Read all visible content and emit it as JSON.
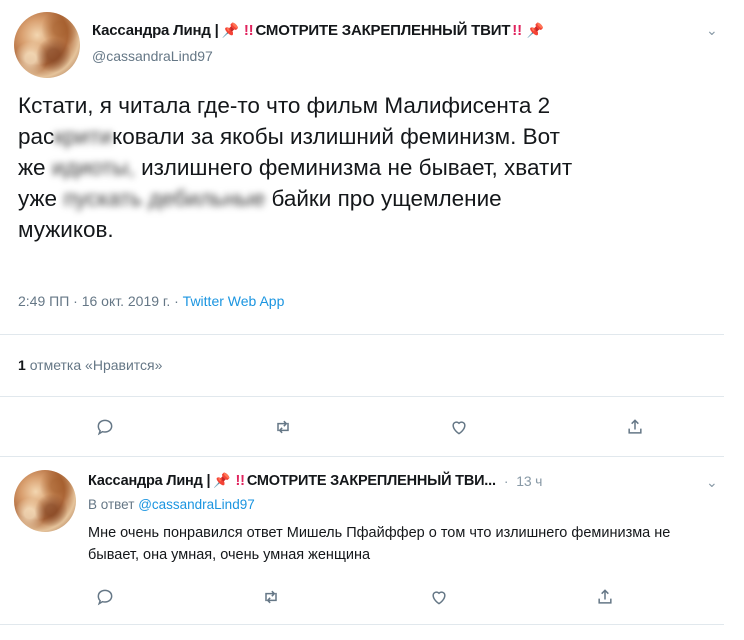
{
  "main_tweet": {
    "author_name": "Кассандра Линд |",
    "pin_icon": "📌",
    "bang": "!!",
    "pinned_label": "СМОТРИТЕ ЗАКРЕПЛЕННЫЙ ТВИТ",
    "handle": "@cassandraLind97",
    "text_line1": "Кстати, я читала где-то что фильм Малифисента 2",
    "text_line2_a": "рас",
    "text_line2_blur": "крити",
    "text_line2_b": "ковали за якобы излишний феминизм. Вот",
    "text_line3_a": "же ",
    "text_line3_blur": "идиоты,",
    "text_line3_b": " излишнего феминизма не бывает, хватит",
    "text_line4_a": "уже ",
    "text_line4_blur": "пускать дебильные",
    "text_line4_b": " байки про ущемление",
    "text_line5": "мужиков.",
    "time": "2:49 ПП",
    "sep": "·",
    "date": "16 окт. 2019 г.",
    "app": "Twitter Web App",
    "likes_count": "1",
    "likes_label": "отметка «Нравится»"
  },
  "reply_tweet": {
    "author_name": "Кассандра Линд |",
    "pin_icon": "📌",
    "bang": "!!",
    "pinned_label": "СМОТРИТЕ ЗАКРЕПЛЕННЫЙ ТВИ...",
    "sep": "·",
    "time_ago": "13 ч",
    "reply_prefix": "В ответ",
    "reply_handle": "@cassandraLind97",
    "text": "Мне очень понравился ответ Мишель Пфайффер о том что излишнего феминизма не бывает, она умная, очень умная женщина"
  },
  "icons": {
    "menu": "chevron-down-icon",
    "reply": "reply-icon",
    "retweet": "retweet-icon",
    "like": "heart-icon",
    "share": "share-icon"
  },
  "colors": {
    "link": "#1b95e0",
    "pin_red": "#d33a3a",
    "muted": "#657786"
  }
}
